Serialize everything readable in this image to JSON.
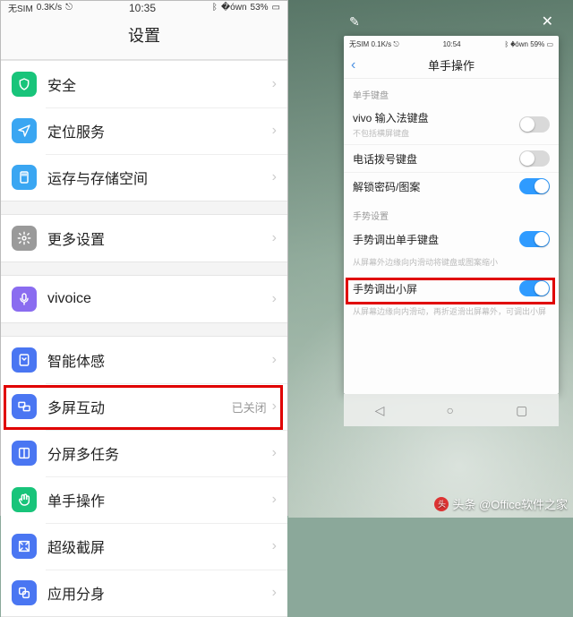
{
  "left": {
    "statusbar": {
      "carrier": "无SIM",
      "speed": "0.3K/s",
      "time": "10:35",
      "battery": "53%"
    },
    "title": "设置",
    "groups": [
      [
        {
          "icon": "shield-icon",
          "color": "#18c47a",
          "label": "安全"
        },
        {
          "icon": "location-icon",
          "color": "#3aa6f2",
          "label": "定位服务"
        },
        {
          "icon": "sd-icon",
          "color": "#3aa6f2",
          "label": "运存与存储空间"
        }
      ],
      [
        {
          "icon": "gear-icon",
          "color": "#9a9a9a",
          "label": "更多设置"
        }
      ],
      [
        {
          "icon": "mic-icon",
          "color": "#8a6cf0",
          "label": "vivoice"
        }
      ],
      [
        {
          "icon": "sense-icon",
          "color": "#4a76f2",
          "label": "智能体感"
        },
        {
          "icon": "cast-icon",
          "color": "#4a76f2",
          "label": "多屏互动",
          "sub": "已关闭"
        },
        {
          "icon": "split-icon",
          "color": "#4a76f2",
          "label": "分屏多任务"
        },
        {
          "icon": "hand-icon",
          "color": "#18c47a",
          "label": "单手操作"
        },
        {
          "icon": "screenshot-icon",
          "color": "#4a76f2",
          "label": "超级截屏"
        },
        {
          "icon": "clone-icon",
          "color": "#4a76f2",
          "label": "应用分身"
        }
      ]
    ]
  },
  "right": {
    "winbar": {
      "edit": "✎",
      "close": "✕"
    },
    "statusbar": {
      "carrier": "无SIM",
      "speed": "0.1K/s",
      "time": "10:54",
      "battery": "59%"
    },
    "title": "单手操作",
    "section1_label": "单手键盘",
    "rows1": [
      {
        "label": "vivo 输入法键盘",
        "sub": "不包括横屏键盘",
        "on": false
      },
      {
        "label": "电话拨号键盘",
        "on": false
      },
      {
        "label": "解锁密码/图案",
        "on": true
      }
    ],
    "section2_label": "手势设置",
    "rows2": [
      {
        "label": "手势调出单手键盘",
        "on": true
      }
    ],
    "hint1": "从屏幕外边缘向内滑动将键盘或图案缩小",
    "rows3": [
      {
        "label": "手势调出小屏",
        "on": true
      }
    ],
    "hint2": "从屏幕边缘向内滑动，再折返滑出屏幕外，可调出小屏",
    "nav": {
      "back": "◁",
      "home": "○",
      "recent": "▢"
    }
  },
  "watermark": "头条 @Office软件之家"
}
